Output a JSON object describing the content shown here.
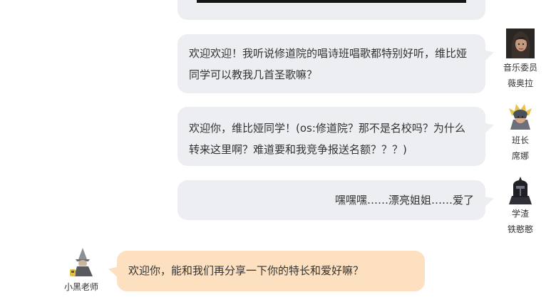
{
  "messages": [
    {
      "text": "欢迎欢迎！我听说修道院的唱诗班唱歌都特别好听，维比娅同学可以教我几首圣歌嘛？",
      "name_lines": [
        "音乐委员",
        "薇奥拉"
      ],
      "avatar_icon": "dark-haired-woman-portrait"
    },
    {
      "text": "欢迎你，维比娅同学！(os:修道院？那不是名校吗？为什么转来这里啊？难道要和我竞争报送名额？？？)",
      "name_lines": [
        "班长",
        "席娜"
      ],
      "avatar_icon": "armored-blonde-knight-portrait"
    },
    {
      "text": "嘿嘿嘿……漂亮姐姐……爱了",
      "name_lines": [
        "学渣",
        "铁憨憨"
      ],
      "avatar_icon": "black-armored-knight-portrait"
    },
    {
      "text": "欢迎你，能和我们再分享一下你的特长和爱好嘛？",
      "name_lines": [
        "小黑老师"
      ],
      "avatar_icon": "grey-wizard-portrait"
    }
  ],
  "colors": {
    "bubble_gray": "#eceef1",
    "bubble_teacher": "#fde0c0",
    "text": "#333333"
  }
}
